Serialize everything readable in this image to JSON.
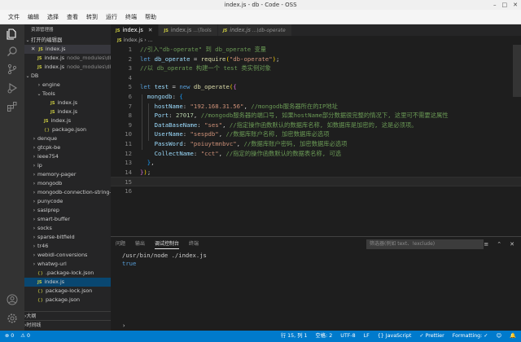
{
  "window": {
    "title": "index.js - db - Code - OSS",
    "minimize": "–",
    "maximize": "□",
    "close": "✕"
  },
  "menu": [
    "文件",
    "编辑",
    "选择",
    "查看",
    "转到",
    "运行",
    "终端",
    "帮助"
  ],
  "activity_icons": [
    "files-icon",
    "search-icon",
    "source-control-icon",
    "run-debug-icon",
    "extensions-icon",
    "account-icon",
    "settings-gear-icon"
  ],
  "sidebar": {
    "title": "资源管理器",
    "open_editors_label": "打开的编辑器",
    "open_editors": [
      {
        "close": "✕",
        "name": "index.js",
        "path": ""
      },
      {
        "close": "",
        "name": "index.js",
        "path": "node_modules\\db..."
      },
      {
        "close": "",
        "name": "index.js",
        "path": "node_modules\\db..."
      }
    ],
    "folder_label": "DB",
    "tree": [
      {
        "chev": "›",
        "type": "folder",
        "name": "engine"
      },
      {
        "chev": "⌄",
        "type": "folder",
        "name": "Tools"
      },
      {
        "chev": "",
        "type": "js",
        "name": "index.js"
      },
      {
        "chev": "",
        "type": "js",
        "name": "index.js"
      },
      {
        "chev": "",
        "type": "js",
        "name": "index.js"
      },
      {
        "chev": "",
        "type": "json",
        "name": "package.json"
      },
      {
        "chev": "›",
        "type": "folder",
        "name": "denque"
      },
      {
        "chev": "›",
        "type": "folder",
        "name": "gtcpk-be"
      },
      {
        "chev": "›",
        "type": "folder",
        "name": "ieee754"
      },
      {
        "chev": "›",
        "type": "folder",
        "name": "ip"
      },
      {
        "chev": "›",
        "type": "folder",
        "name": "memory-pager"
      },
      {
        "chev": "›",
        "type": "folder",
        "name": "mongodb"
      },
      {
        "chev": "›",
        "type": "folder",
        "name": "mongodb-connection-string-..."
      },
      {
        "chev": "›",
        "type": "folder",
        "name": "punycode"
      },
      {
        "chev": "›",
        "type": "folder",
        "name": "saslprep"
      },
      {
        "chev": "›",
        "type": "folder",
        "name": "smart-buffer"
      },
      {
        "chev": "›",
        "type": "folder",
        "name": "socks"
      },
      {
        "chev": "›",
        "type": "folder",
        "name": "sparse-bitfield"
      },
      {
        "chev": "›",
        "type": "folder",
        "name": "tr46"
      },
      {
        "chev": "›",
        "type": "folder",
        "name": "webidl-conversions"
      },
      {
        "chev": "›",
        "type": "folder",
        "name": "whatwg-url"
      },
      {
        "chev": "",
        "type": "json",
        "name": ".package-lock.json"
      },
      {
        "chev": "",
        "type": "js",
        "name": "index.js"
      },
      {
        "chev": "",
        "type": "json",
        "name": "package-lock.json"
      },
      {
        "chev": "",
        "type": "json",
        "name": "package.json"
      }
    ],
    "outline_label": "大纲",
    "timeline_label": "时间线"
  },
  "tabs": [
    {
      "name": "index.js",
      "path": "",
      "active": true,
      "close": "✕"
    },
    {
      "name": "index.js",
      "path": "...\\Tools",
      "active": false,
      "close": ""
    },
    {
      "name": "index.js",
      "path": "...\\db-operate",
      "active": false,
      "close": ""
    }
  ],
  "breadcrumb": {
    "file": "index.js",
    "sep": "›",
    "symbol": "..."
  },
  "code": {
    "current_line": 15,
    "lines": [
      [
        [
          "c-com",
          "//引入\"db-operate\" 到 db_operate 变量"
        ]
      ],
      [
        [
          "c-kw",
          "let "
        ],
        [
          "c-var",
          "db_operate"
        ],
        [
          "c-pun",
          " = "
        ],
        [
          "c-fn",
          "require"
        ],
        [
          "c-br1",
          "("
        ],
        [
          "c-str",
          "\"db-operate\""
        ],
        [
          "c-br1",
          ")"
        ],
        [
          "c-pun",
          ";"
        ]
      ],
      [
        [
          "c-com",
          "//以 db_operate 构建一个 test 类实例对象"
        ]
      ],
      [],
      [
        [
          "c-kw",
          "let "
        ],
        [
          "c-var",
          "test"
        ],
        [
          "c-pun",
          " = "
        ],
        [
          "c-kw",
          "new "
        ],
        [
          "c-fn",
          "db_operate"
        ],
        [
          "c-br1",
          "("
        ],
        [
          "c-br2",
          "{"
        ]
      ],
      [
        [
          "c-pun",
          "  "
        ],
        [
          "c-var",
          "mongodb"
        ],
        [
          "c-pun",
          ": "
        ],
        [
          "c-br3",
          "{"
        ]
      ],
      [
        [
          "c-pun",
          "    "
        ],
        [
          "c-var",
          "hostName"
        ],
        [
          "c-pun",
          ": "
        ],
        [
          "c-str",
          "\"192.168.31.56\""
        ],
        [
          "c-pun",
          ", "
        ],
        [
          "c-com",
          "//mongodb服务器所在的IP地址"
        ]
      ],
      [
        [
          "c-pun",
          "    "
        ],
        [
          "c-var",
          "Port"
        ],
        [
          "c-pun",
          ": "
        ],
        [
          "c-num",
          "27017"
        ],
        [
          "c-pun",
          ", "
        ],
        [
          "c-com",
          "//mongodb服务器的端口号, 如果hostName部分数据很完整的情况下, 这里可不需要这属性"
        ]
      ],
      [
        [
          "c-pun",
          "    "
        ],
        [
          "c-var",
          "DataBaseName"
        ],
        [
          "c-pun",
          ": "
        ],
        [
          "c-str",
          "\"ses\""
        ],
        [
          "c-pun",
          ", "
        ],
        [
          "c-com",
          "//指定操作函数默认的数据库名称, 如数据库是加密的, 这是必须项。"
        ]
      ],
      [
        [
          "c-pun",
          "    "
        ],
        [
          "c-var",
          "UserName"
        ],
        [
          "c-pun",
          ": "
        ],
        [
          "c-str",
          "\"sespdb\""
        ],
        [
          "c-pun",
          ", "
        ],
        [
          "c-com",
          "//数据库账户名称, 加密数据库必选项"
        ]
      ],
      [
        [
          "c-pun",
          "    "
        ],
        [
          "c-var",
          "PassWord"
        ],
        [
          "c-pun",
          ": "
        ],
        [
          "c-str",
          "\"poiuytmnbvc\""
        ],
        [
          "c-pun",
          ", "
        ],
        [
          "c-com",
          "//数据库账户密码, 加密数据库必选项"
        ]
      ],
      [
        [
          "c-pun",
          "    "
        ],
        [
          "c-var",
          "CollectName"
        ],
        [
          "c-pun",
          ": "
        ],
        [
          "c-str",
          "\"cct\""
        ],
        [
          "c-pun",
          ", "
        ],
        [
          "c-com",
          "//指定的操作函数默认的数据表名称, 可选"
        ]
      ],
      [
        [
          "c-pun",
          "  "
        ],
        [
          "c-br3",
          "}"
        ],
        [
          "c-pun",
          ","
        ]
      ],
      [
        [
          "c-br2",
          "}"
        ],
        [
          "c-br1",
          ")"
        ],
        [
          "c-pun",
          ";"
        ]
      ],
      [],
      []
    ]
  },
  "panel": {
    "tabs": [
      "问题",
      "输出",
      "调试控制台",
      "终端"
    ],
    "active_tab": 2,
    "filter_placeholder": "筛选器(例如 text、!exclude)",
    "output": [
      "/usr/bin/node ./index.js",
      "true"
    ],
    "icons": {
      "collapse": "≡",
      "maximize": "⌃",
      "close": "✕"
    }
  },
  "status": {
    "errors": "⊗ 0",
    "warnings": "⚠ 0",
    "position": "行 15, 列 1",
    "spaces": "空格: 2",
    "encoding": "UTF-8",
    "eol": "LF",
    "language": "{} JavaScript",
    "prettier": "✓ Prettier",
    "formatting": "Formatting: ✓",
    "feedback": "☺",
    "bell": "🔔"
  }
}
